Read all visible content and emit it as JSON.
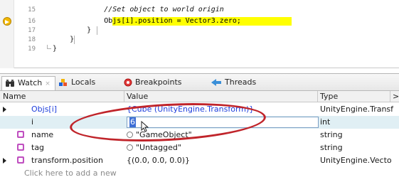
{
  "editor": {
    "lines": [
      {
        "number": "15",
        "text": "            //Set object to world origin",
        "comment": true
      },
      {
        "number": "16",
        "text": "            Objs[i].position = Vector3.zero;",
        "highlighted": true
      },
      {
        "number": "17",
        "text": "        }"
      },
      {
        "number": "18",
        "text": "    }"
      },
      {
        "number": "19",
        "text": "}"
      }
    ],
    "current_line_marker_color": "#f2b800",
    "highlight_color": "#ffff00"
  },
  "tabs": [
    {
      "label": "Watch",
      "icon": "binoculars-icon",
      "active": true,
      "close": "×"
    },
    {
      "label": "Locals",
      "icon": "locals-icon"
    },
    {
      "label": "Breakpoints",
      "icon": "breakpoint-icon"
    },
    {
      "label": "Threads",
      "icon": "threads-icon"
    }
  ],
  "columns": {
    "name": "Name",
    "value": "Value",
    "type": "Type"
  },
  "rows": [
    {
      "name": "Objs[i]",
      "value": "{Cube (UnityEngine.Transform)}",
      "type": "UnityEngine.Transf",
      "expandable": true,
      "name_color": "#1f3fdc",
      "value_color": "#1f3fdc"
    },
    {
      "name": "i",
      "value": "6",
      "type": "int",
      "editing": true
    },
    {
      "name": "name",
      "value": "\"GameObject\"",
      "type": "string",
      "icon": "property-icon",
      "inspect": true
    },
    {
      "name": "tag",
      "value": "\"Untagged\"",
      "type": "string",
      "icon": "property-icon",
      "inspect": true
    },
    {
      "name": "transform.position",
      "value": "{(0.0, 0.0, 0.0)}",
      "type": "UnityEngine.Vecto",
      "icon": "property-icon",
      "expandable": true
    }
  ],
  "add_hint": "Click here to add a new",
  "annotation_color": "#c0242a"
}
